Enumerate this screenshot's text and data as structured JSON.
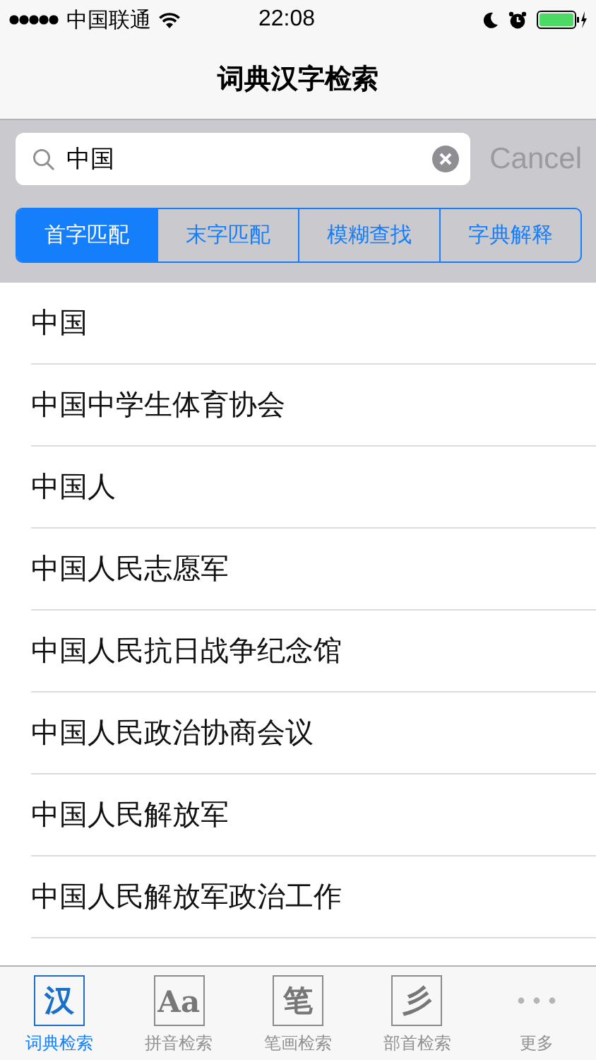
{
  "status_bar": {
    "carrier": "中国联通",
    "time": "22:08"
  },
  "nav": {
    "title": "词典汉字检索"
  },
  "search": {
    "value": "中国",
    "cancel": "Cancel"
  },
  "segments": [
    {
      "label": "首字匹配",
      "selected": true
    },
    {
      "label": "末字匹配",
      "selected": false
    },
    {
      "label": "模糊查找",
      "selected": false
    },
    {
      "label": "字典解释",
      "selected": false
    }
  ],
  "results": [
    "中国",
    "中国中学生体育协会",
    "中国人",
    "中国人民志愿军",
    "中国人民抗日战争纪念馆",
    "中国人民政治协商会议",
    "中国人民解放军",
    "中国人民解放军政治工作"
  ],
  "tab_bar": [
    {
      "kind": "glyph",
      "glyph": "汉",
      "label": "词典检索",
      "selected": true
    },
    {
      "kind": "glyph",
      "glyph": "Aa",
      "label": "拼音检索",
      "selected": false
    },
    {
      "kind": "glyph",
      "glyph": "笔",
      "label": "笔画检索",
      "selected": false
    },
    {
      "kind": "glyph",
      "glyph": "彡",
      "label": "部首检索",
      "selected": false
    },
    {
      "kind": "dots",
      "label": "更多",
      "selected": false
    }
  ]
}
